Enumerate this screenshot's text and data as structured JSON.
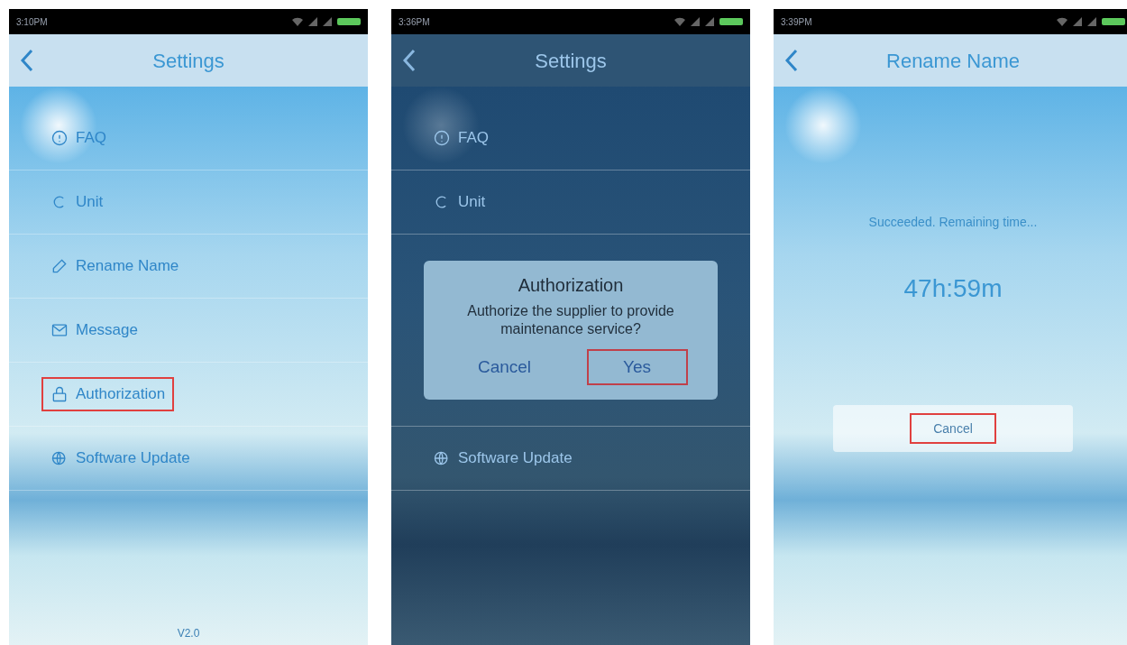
{
  "screens": [
    {
      "status_time": "3:10PM",
      "title": "Settings",
      "dimmed": false,
      "items": [
        {
          "kind": "faq",
          "label": "FAQ",
          "highlighted": false
        },
        {
          "kind": "unit",
          "label": "Unit",
          "highlighted": false
        },
        {
          "kind": "rename",
          "label": "Rename Name",
          "highlighted": false
        },
        {
          "kind": "message",
          "label": "Message",
          "highlighted": false
        },
        {
          "kind": "lock",
          "label": "Authorization",
          "highlighted": true
        },
        {
          "kind": "update",
          "label": "Software Update",
          "highlighted": false
        }
      ],
      "version": "V2.0"
    },
    {
      "status_time": "3:36PM",
      "title": "Settings",
      "dimmed": true,
      "items": [
        {
          "kind": "faq",
          "label": "FAQ",
          "highlighted": false
        },
        {
          "kind": "unit",
          "label": "Unit",
          "highlighted": false
        }
      ],
      "dialog": {
        "title": "Authorization",
        "message": "Authorize the supplier to provide maintenance service?",
        "buttons": [
          {
            "label": "Cancel",
            "highlighted": false
          },
          {
            "label": "Yes",
            "highlighted": true
          }
        ]
      },
      "items_below": [
        {
          "kind": "update",
          "label": "Software Update",
          "highlighted": false
        }
      ]
    },
    {
      "status_time": "3:39PM",
      "title": "Rename Name",
      "dimmed": false,
      "message": "Succeeded. Remaining time...",
      "countdown": "47h:59m",
      "cancel": {
        "label": "Cancel",
        "highlighted": true
      }
    }
  ]
}
